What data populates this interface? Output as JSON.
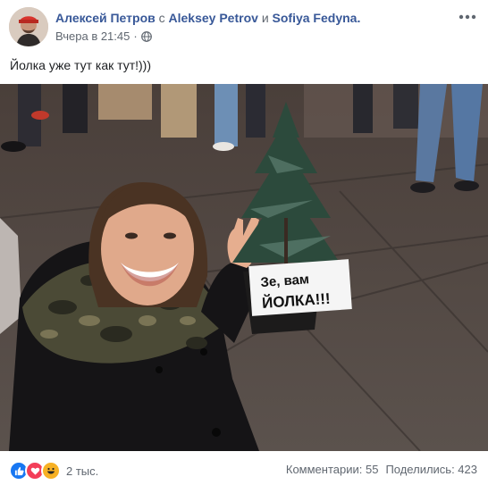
{
  "post": {
    "author": "Алексей Петров",
    "with_word": "с",
    "and_word": "и",
    "tagged": [
      "Aleksey Petrov",
      "Sofiya Fedyna."
    ],
    "timestamp": "Вчера в 21:45",
    "separator": "·",
    "privacy_icon": "globe-icon",
    "menu_icon": "more-horizontal-icon",
    "text": "Йолка уже тут как тут!)))"
  },
  "photo": {
    "sign_line1": "Зе, вам",
    "sign_line2": "ЙОЛКА!!!"
  },
  "footer": {
    "reaction_icons": [
      "like-icon",
      "love-icon",
      "haha-icon"
    ],
    "reaction_count": "2 тыс.",
    "comments": "Комментарии: 55",
    "shares": "Поделились: 423"
  },
  "colors": {
    "link": "#385898",
    "meta": "#606770",
    "like": "#1877f2",
    "love": "#f33e58",
    "haha": "#f7b125"
  }
}
